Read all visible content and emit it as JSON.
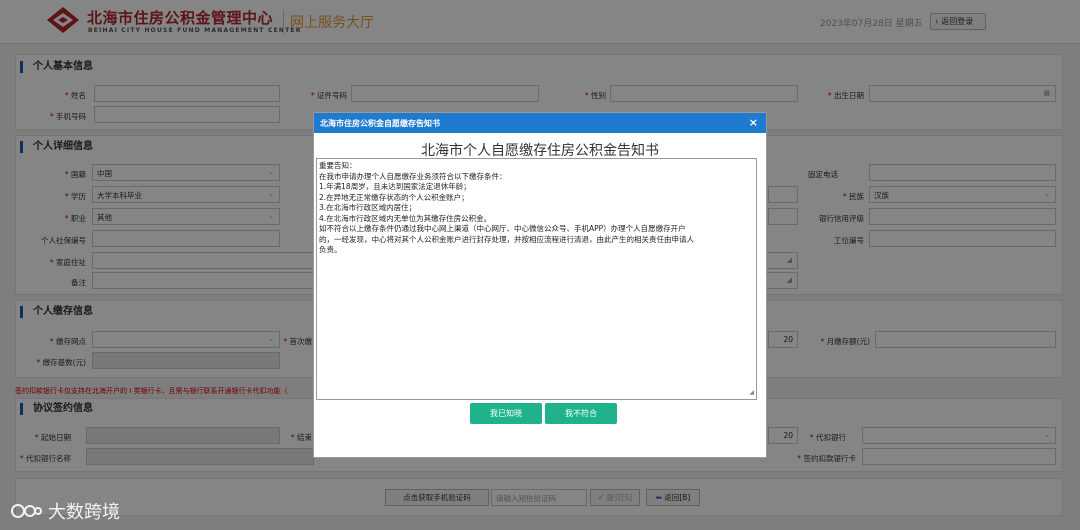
{
  "header": {
    "logo_cn": "北海市住房公积金管理中心",
    "logo_en": "BEIHAI CITY HOUSE FUND MANAGEMENT CENTER",
    "portal": "网上服务大厅",
    "date": "2023年07月28日 星期五",
    "back_label": "返回登录"
  },
  "basic": {
    "title": "个人基本信息",
    "name_label": "姓名",
    "id_label": "证件号码",
    "gender_label": "性别",
    "birth_label": "出生日期",
    "phone_label": "手机号码"
  },
  "detail": {
    "title": "个人详细信息",
    "nationality_label": "国籍",
    "nationality": "中国",
    "phone_fixed_label": "固定电话",
    "edu_label": "学历",
    "edu": "大学本科毕业",
    "ethnic_label": "民族",
    "ethnic": "汉族",
    "job_label": "职业",
    "job": "其他",
    "bank_level_label": "银行信用评级",
    "social_label": "个人社保编号",
    "work_id_label": "工位编号",
    "address_label": "家庭住址",
    "remark_label": "备注"
  },
  "deposit": {
    "title": "个人缴存信息",
    "site_label": "缴存网点",
    "first_label": "首次缴",
    "base_label": "缴存基数(元)",
    "ratio": "20",
    "monthly_label": "月缴存额(元)"
  },
  "warning": "签约扣款银行卡仅支持在北海开户的 I 类银行卡，且需与银行联系开通银行卡代扣功能（",
  "agreement": {
    "title": "协议签约信息",
    "start_label": "起始日期",
    "end_label": "结束",
    "ratio": "20",
    "bank_label": "代扣银行",
    "bank_name_label": "代扣银行名称",
    "card_label": "签约扣款银行卡"
  },
  "bottom": {
    "sms_btn": "点击获取手机验证码",
    "sms_placeholder": "请输入短信验证码",
    "submit": "提交[S]",
    "back": "返回[B]"
  },
  "modal": {
    "header": "北海市住房公积金自愿缴存告知书",
    "title": "北海市个人自愿缴存住房公积金告知书",
    "lines": [
      "重要告知：",
      " 在我市申请办理个人自愿缴存业务须符合以下缴存条件：",
      "1.年满18周岁，且未达到国家法定退休年龄；",
      "2.在异地无正常缴存状态的个人公积金账户；",
      "3.在北海市行政区域内居住；",
      "4.在北海市行政区域内无单位为其缴存住房公积金。",
      "如不符合以上缴存条件仍通过我中心网上渠道（中心网厅、中心微信公众号、手机APP）办理个人自愿缴存开户",
      "的，一经发现，中心将对其个人公积金账户进行封存处理，并按相应流程进行清退，由此产生的相关责任由申请人",
      "负责。"
    ],
    "confirm": "我已知晓",
    "reject": "我不符合"
  },
  "watermark": "大数跨境",
  "colors": {
    "brand_red": "#b1282e",
    "accent_orange": "#e39b3a",
    "modal_blue": "#1f7bd0",
    "button_green": "#1fb28d"
  }
}
